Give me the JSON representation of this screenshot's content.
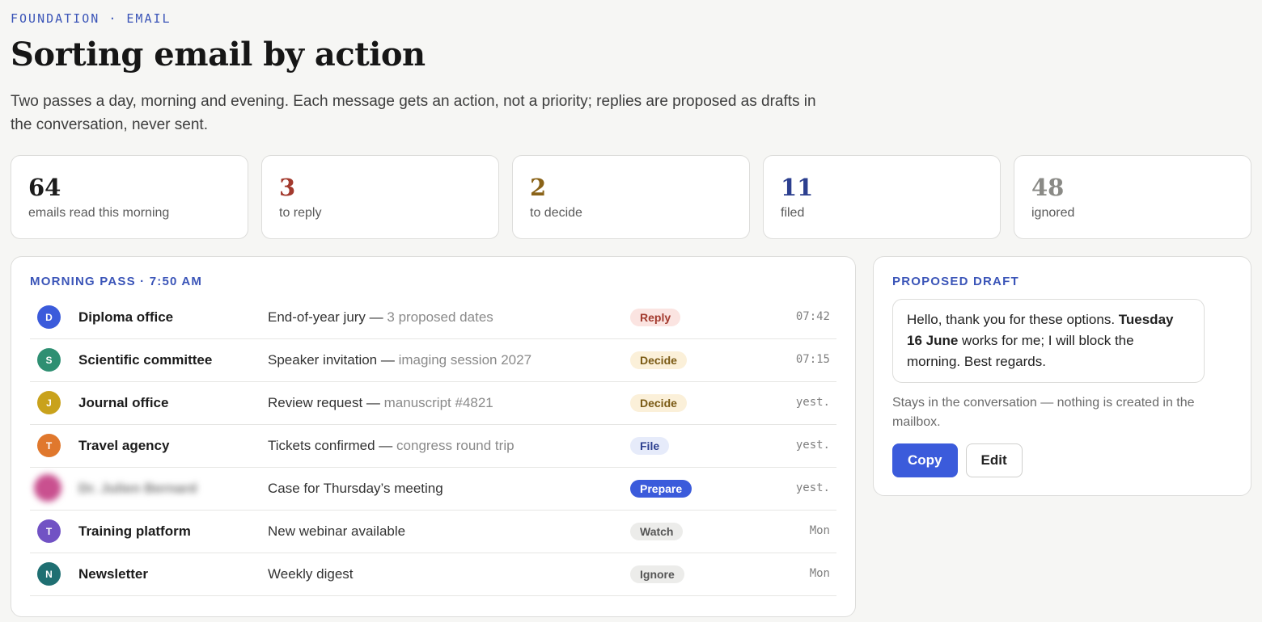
{
  "header": {
    "eyebrow": "FOUNDATION · EMAIL",
    "title": "Sorting email by action",
    "intro": "Two passes a day, morning and evening. Each message gets an action, not a priority; replies are proposed as drafts in the conversation, never sent."
  },
  "stats": [
    {
      "value": "64",
      "label": "emails read this morning",
      "color": "#1c1c1c"
    },
    {
      "value": "3",
      "label": "to reply",
      "color": "#a33a2e"
    },
    {
      "value": "2",
      "label": "to decide",
      "color": "#8a6318"
    },
    {
      "value": "11",
      "label": "filed",
      "color": "#2c3f8f"
    },
    {
      "value": "48",
      "label": "ignored",
      "color": "#8a8a86"
    }
  ],
  "morning_pass": {
    "heading": "MORNING PASS · 7:50 AM",
    "rows": [
      {
        "initial": "D",
        "avatar_color": "#3b5bdb",
        "sender": "Diploma office",
        "subject": "End-of-year jury — ",
        "subject_detail": "3 proposed dates",
        "action": "Reply",
        "badge_bg": "#fbe4e1",
        "badge_fg": "#a33a2e",
        "time": "07:42"
      },
      {
        "initial": "S",
        "avatar_color": "#2e8f72",
        "sender": "Scientific committee",
        "subject": "Speaker invitation — ",
        "subject_detail": "imaging session 2027",
        "action": "Decide",
        "badge_bg": "#fbf0d9",
        "badge_fg": "#7a5a14",
        "time": "07:15"
      },
      {
        "initial": "J",
        "avatar_color": "#c9a21c",
        "sender": "Journal office",
        "subject": "Review request — ",
        "subject_detail": "manuscript #4821",
        "action": "Decide",
        "badge_bg": "#fbf0d9",
        "badge_fg": "#7a5a14",
        "time": "yest."
      },
      {
        "initial": "T",
        "avatar_color": "#e0782d",
        "sender": "Travel agency",
        "subject": "Tickets confirmed — ",
        "subject_detail": "congress round trip",
        "action": "File",
        "badge_bg": "#e6ebfa",
        "badge_fg": "#2c3f8f",
        "time": "yest."
      },
      {
        "initial": "",
        "avatar_color": "#c9508f",
        "sender": "Dr. Julien Bernard",
        "blurred": true,
        "subject": "Case for Thursday’s meeting",
        "subject_detail": "",
        "action": "Prepare",
        "badge_bg": "#3b5bdb",
        "badge_fg": "#ffffff",
        "time": "yest."
      },
      {
        "initial": "T",
        "avatar_color": "#7152c4",
        "sender": "Training platform",
        "subject": "New webinar available",
        "subject_detail": "",
        "action": "Watch",
        "badge_bg": "#ececea",
        "badge_fg": "#555555",
        "time": "Mon"
      },
      {
        "initial": "N",
        "avatar_color": "#1f6f72",
        "sender": "Newsletter",
        "subject": "Weekly digest",
        "subject_detail": "",
        "action": "Ignore",
        "badge_bg": "#ececea",
        "badge_fg": "#555555",
        "time": "Mon"
      }
    ]
  },
  "draft": {
    "heading": "PROPOSED DRAFT",
    "line_before": "Hello, thank you for these options. ",
    "highlight": "Tuesday 16 June",
    "line_after": " works for me; I will block the morning. Best regards.",
    "note": "Stays in the conversation — nothing is created in the mailbox.",
    "copy_label": "Copy",
    "edit_label": "Edit"
  }
}
